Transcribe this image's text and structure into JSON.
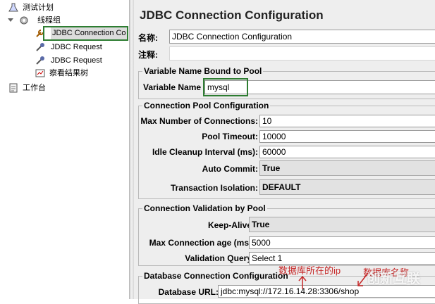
{
  "tree": {
    "items": [
      {
        "label": "测试计划",
        "icon": "flask-icon"
      },
      {
        "label": "线程组",
        "icon": "gear-icon"
      },
      {
        "label": "JDBC Connection Co",
        "icon": "wrench-icon"
      },
      {
        "label": "JDBC Request",
        "icon": "pipette-icon"
      },
      {
        "label": "JDBC Request",
        "icon": "pipette-icon"
      },
      {
        "label": "察看结果树",
        "icon": "chart-icon"
      },
      {
        "label": "工作台",
        "icon": "clipboard-icon"
      }
    ]
  },
  "panel": {
    "title": "JDBC Connection Configuration",
    "name_label": "名称:",
    "name_value": "JDBC Connection Configuration",
    "comment_label": "注释:",
    "pool_var": {
      "group_title": "Variable Name Bound to Pool",
      "label": "Variable Name",
      "value": "mysql"
    },
    "pool_config": {
      "group_title": "Connection Pool Configuration",
      "max_conn_label": "Max Number of Connections:",
      "max_conn_value": "10",
      "timeout_label": "Pool Timeout:",
      "timeout_value": "10000",
      "idle_label": "Idle Cleanup Interval (ms):",
      "idle_value": "60000",
      "autocommit_label": "Auto Commit:",
      "autocommit_value": "True",
      "isolation_label": "Transaction Isolation:",
      "isolation_value": "DEFAULT"
    },
    "validation": {
      "group_title": "Connection Validation by Pool",
      "keepalive_label": "Keep-Alive:",
      "keepalive_value": "True",
      "maxage_label": "Max Connection age (ms):",
      "maxage_value": "5000",
      "query_label": "Validation Query:",
      "query_value": "Select 1"
    },
    "db_config": {
      "group_title": "Database Connection Configuration",
      "url_label": "Database URL:",
      "url_value": "jdbc:mysql://172.16.14.28:3306/shop"
    }
  },
  "annotations": {
    "host_note": "数据库所在的ip",
    "db_note": "数据库名称"
  },
  "watermark": "创新互联",
  "colors": {
    "highlight": "#2e7d32",
    "annotation": "#c62828"
  }
}
